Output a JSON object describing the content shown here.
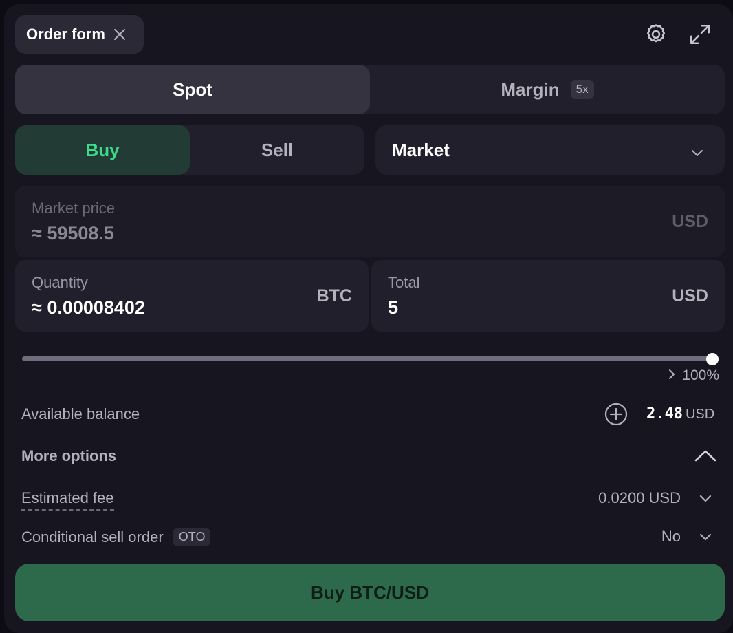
{
  "header": {
    "tab_label": "Order form",
    "icons": [
      "close-icon",
      "gear-icon",
      "expand-icon"
    ]
  },
  "mode_tabs": {
    "spot_label": "Spot",
    "margin_label": "Margin",
    "margin_badge": "5x",
    "selected": "Spot"
  },
  "side_tabs": {
    "buy_label": "Buy",
    "sell_label": "Sell",
    "selected": "Buy"
  },
  "order_type": {
    "value": "Market"
  },
  "market_price": {
    "label": "Market price",
    "value": "≈ 59508.5",
    "unit": "USD"
  },
  "quantity": {
    "label": "Quantity",
    "value": "≈ 0.00008402",
    "unit": "BTC"
  },
  "total": {
    "label": "Total",
    "value": "5",
    "unit": "USD"
  },
  "slider": {
    "percent_label": "100%",
    "fraction": 1.0
  },
  "balance": {
    "label": "Available balance",
    "value": "2.48",
    "unit": "USD"
  },
  "more_options": {
    "label": "More options"
  },
  "fee": {
    "label": "Estimated fee",
    "value": "0.0200 USD"
  },
  "conditional": {
    "label": "Conditional sell order",
    "badge": "OTO",
    "value": "No"
  },
  "submit": {
    "label": "Buy BTC/USD"
  },
  "colors": {
    "accent_green": "#3ddc8c",
    "buy_button": "#2d6a4b",
    "panel": "#17151f"
  }
}
